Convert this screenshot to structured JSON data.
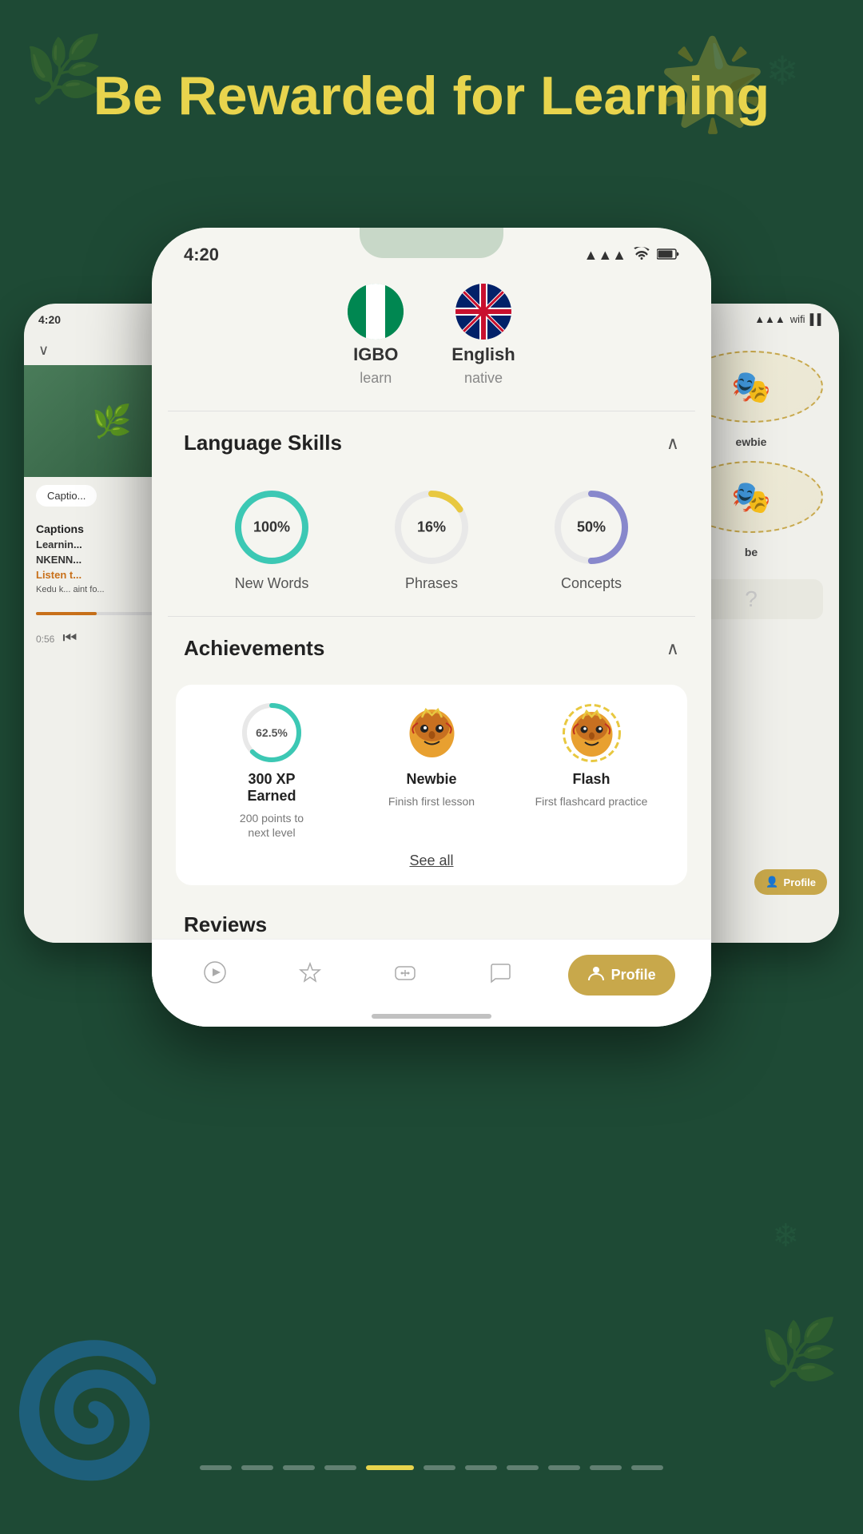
{
  "page": {
    "bg_color": "#1e4a35",
    "title": "Be Rewarded for Learning"
  },
  "status_bar": {
    "time": "4:20",
    "signal": "▲▲▲",
    "wifi": "wifi",
    "battery": "battery"
  },
  "languages": [
    {
      "name": "IGBO",
      "label": "learn",
      "flag": "🇳🇬"
    },
    {
      "name": "English",
      "label": "native",
      "flag": "🇬🇧"
    }
  ],
  "language_skills": {
    "title": "Language Skills",
    "items": [
      {
        "label": "New Words",
        "percent": 100,
        "color": "#3cc8b4",
        "trail": "#e8e8e8"
      },
      {
        "label": "Phrases",
        "percent": 16,
        "color": "#e8c840",
        "trail": "#e8e8e8"
      },
      {
        "label": "Concepts",
        "percent": 50,
        "color": "#8888cc",
        "trail": "#e8e8e8"
      }
    ]
  },
  "achievements": {
    "title": "Achievements",
    "items": [
      {
        "type": "xp",
        "percent": 62.5,
        "title": "300 XP\nEarned",
        "sub": "200 points to\nnext level"
      },
      {
        "type": "badge",
        "emoji": "🎭",
        "title": "Newbie",
        "sub": "Finish first\nlesson"
      },
      {
        "type": "badge",
        "emoji": "🎭",
        "title": "Flash",
        "sub": "First\nflashcard\npractice"
      }
    ],
    "see_all": "See all"
  },
  "reviews": {
    "title": "Reviews"
  },
  "bottom_nav": {
    "items": [
      {
        "icon": "▶",
        "label": "Play",
        "active": false
      },
      {
        "icon": "☆",
        "label": "Favorites",
        "active": false
      },
      {
        "icon": "🎮",
        "label": "Practice",
        "active": false
      },
      {
        "icon": "💬",
        "label": "Chat",
        "active": false
      },
      {
        "icon": "👤",
        "label": "Profile",
        "active": true
      }
    ]
  },
  "left_phone": {
    "time": "4:20",
    "caption_btn": "Captio...",
    "section_title": "Captions",
    "text_intro": "Learnin...",
    "text_name": "NKENN...",
    "text_orange": "Listen t...",
    "text_body": "Kedu k...\naint fo...",
    "time_display": "0:56"
  },
  "pagination": {
    "dots": [
      0,
      1,
      2,
      3,
      4,
      5,
      6,
      7,
      8,
      9,
      10
    ],
    "active_index": 4
  }
}
